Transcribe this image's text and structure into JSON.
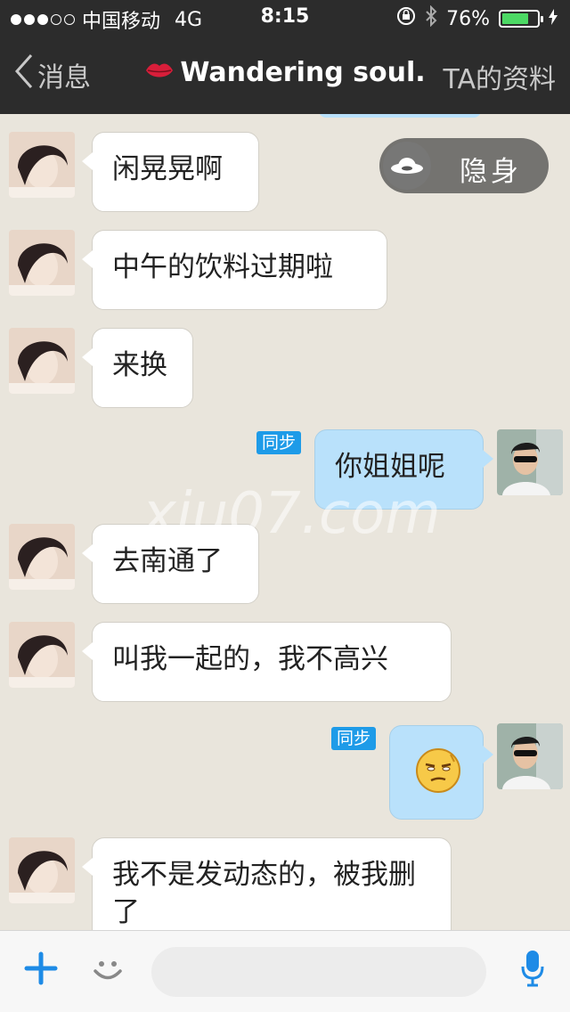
{
  "status_bar": {
    "carrier": "中国移动",
    "network": "4G",
    "time": "8:15",
    "battery_percent": "76%",
    "battery_level": 0.76,
    "signal_strength": 3
  },
  "nav": {
    "back_label": "消息",
    "title": "Wandering soul.",
    "profile_label": "TA的资料"
  },
  "invisible_toggle": {
    "label": "隐身"
  },
  "sync_label": "同步",
  "watermark": "xiu07.com",
  "messages": [
    {
      "from": "other",
      "text": "闲晃晃啊"
    },
    {
      "from": "other",
      "text": "中午的饮料过期啦"
    },
    {
      "from": "other",
      "text": "来换"
    },
    {
      "from": "me",
      "text": "你姐姐呢"
    },
    {
      "from": "other",
      "text": "去南通了"
    },
    {
      "from": "other",
      "text": "叫我一起的，我不高兴"
    },
    {
      "from": "me",
      "text": "",
      "emoji": "smirk-emoji"
    },
    {
      "from": "other",
      "text": "我不是发动态的，被我删了"
    }
  ],
  "colors": {
    "nav_bg": "#2c2c2c",
    "chat_bg": "#e9e5dc",
    "incoming_bubble": "#ffffff",
    "outgoing_bubble": "#b9e1fb",
    "sync_badge": "#1e9be8",
    "accent": "#1e8be6"
  }
}
